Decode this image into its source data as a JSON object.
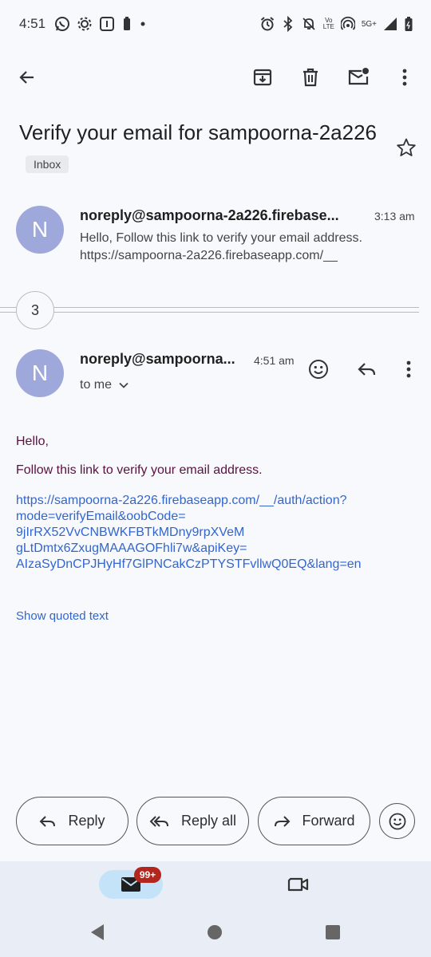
{
  "status_bar": {
    "time": "4:51",
    "volte_top": "Vo",
    "volte_bottom": "LTE",
    "network": "5G+"
  },
  "icons": {
    "back": "arrow-left-icon",
    "archive": "archive-icon",
    "delete": "trash-icon",
    "mark_unread": "mail-unread-icon",
    "more": "more-vert-icon",
    "star": "star-outline-icon"
  },
  "email": {
    "subject": "Verify your email for sampoorna-2a226",
    "label": "Inbox",
    "messages": [
      {
        "avatar_letter": "N",
        "sender": "noreply@sampoorna-2a226.firebase...",
        "time": "3:13 am",
        "snippet_line1": "Hello, Follow this link to verify your email address.",
        "snippet_line2": "https://sampoorna-2a226.firebaseapp.com/__"
      },
      {
        "avatar_letter": "N",
        "sender": "noreply@sampoorna...",
        "time": "4:51 am",
        "recipient": "to me"
      }
    ],
    "collapsed_count": "3",
    "body": {
      "greeting": "Hello,",
      "instruction": "Follow this link to verify your email address.",
      "link_lines": [
        "https://sampoorna-2a226.firebaseapp.com/__/auth/action?",
        "mode=verifyEmail&oobCode=",
        "9jIrRX52VvCNBWKFBTkMDny9rpXVeM",
        "gLtDmtx6ZxugMAAAGOFhli7w&apiKey=",
        "AIzaSyDnCPJHyHf7GlPNCakCzPTYSTFvllwQ0EQ&lang=en"
      ],
      "show_quoted": "Show quoted text"
    }
  },
  "actions": {
    "reply": "Reply",
    "reply_all": "Reply all",
    "forward": "Forward"
  },
  "bottom_nav": {
    "mail_badge": "99+"
  },
  "colors": {
    "background": "#f7f9fd",
    "avatar": "#9fa8da",
    "link": "#3366cc",
    "body_text": "#5b1040",
    "badge": "#b3261e",
    "nav_active": "#c4e2f8"
  }
}
